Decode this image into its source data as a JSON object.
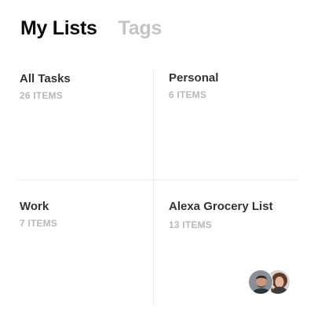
{
  "header": {
    "tabs": [
      {
        "label": "My Lists",
        "active": true
      },
      {
        "label": "Tags",
        "active": false
      }
    ]
  },
  "lists": [
    {
      "title": "All Tasks",
      "count": "26 ITEMS"
    },
    {
      "title": "Personal",
      "count": "6 ITEMS"
    },
    {
      "title": "Work",
      "count": "7 ITEMS"
    },
    {
      "title": "Alexa Grocery List",
      "count": "13 ITEMS",
      "shared_avatars": 2
    }
  ],
  "colors": {
    "active_tab": "#0d0d0d",
    "inactive_tab": "#c4c4c4",
    "list_title": "#333333",
    "list_count": "#b8b8b8",
    "divider": "#ececec"
  }
}
